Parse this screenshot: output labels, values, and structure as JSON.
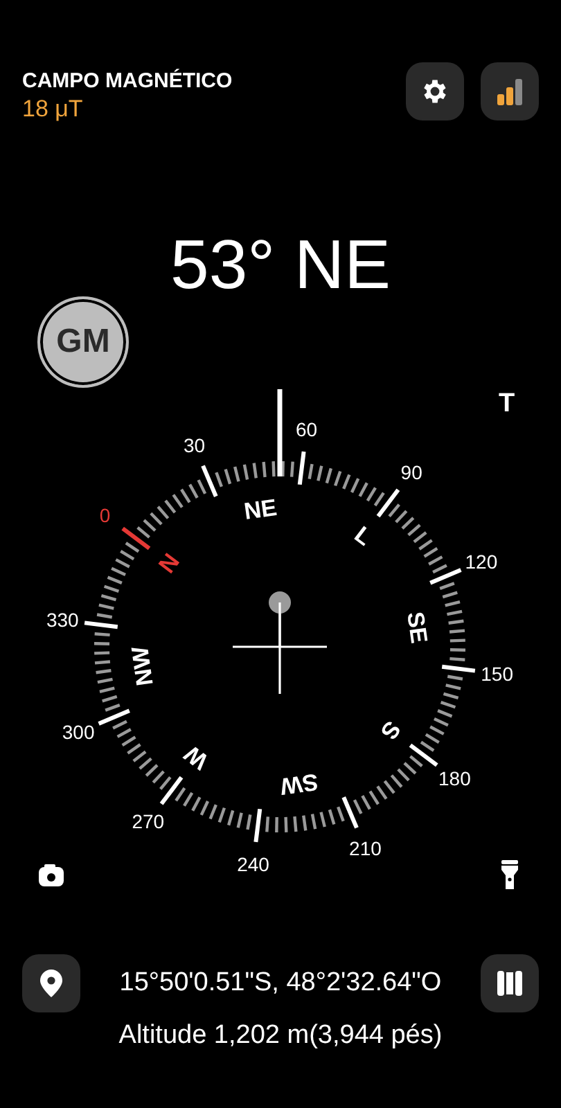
{
  "header": {
    "title": "CAMPO MAGNÉTICO",
    "value": "18 μT"
  },
  "heading": "53° NE",
  "calibration_badge": "GM",
  "true_north_label": "T",
  "dial": {
    "degrees": [
      {
        "label": "0",
        "kind": "north"
      },
      {
        "label": "30",
        "kind": "plain"
      },
      {
        "label": "60",
        "kind": "plain"
      },
      {
        "label": "90",
        "kind": "plain"
      },
      {
        "label": "120",
        "kind": "plain"
      },
      {
        "label": "150",
        "kind": "plain"
      },
      {
        "label": "180",
        "kind": "plain"
      },
      {
        "label": "210",
        "kind": "plain"
      },
      {
        "label": "240",
        "kind": "plain"
      },
      {
        "label": "270",
        "kind": "plain"
      },
      {
        "label": "300",
        "kind": "plain"
      },
      {
        "label": "330",
        "kind": "plain"
      }
    ],
    "directions": [
      {
        "label": "N",
        "kind": "north"
      },
      {
        "label": "NE",
        "kind": "plain"
      },
      {
        "label": "L",
        "kind": "plain"
      },
      {
        "label": "SE",
        "kind": "plain"
      },
      {
        "label": "S",
        "kind": "plain"
      },
      {
        "label": "SW",
        "kind": "plain"
      },
      {
        "label": "W",
        "kind": "plain"
      },
      {
        "label": "NW",
        "kind": "plain"
      }
    ]
  },
  "location": {
    "coordinates": "15°50'0.51\"S, 48°2'32.64\"O",
    "altitude": "Altitude 1,202 m(3,944 pés)"
  }
}
